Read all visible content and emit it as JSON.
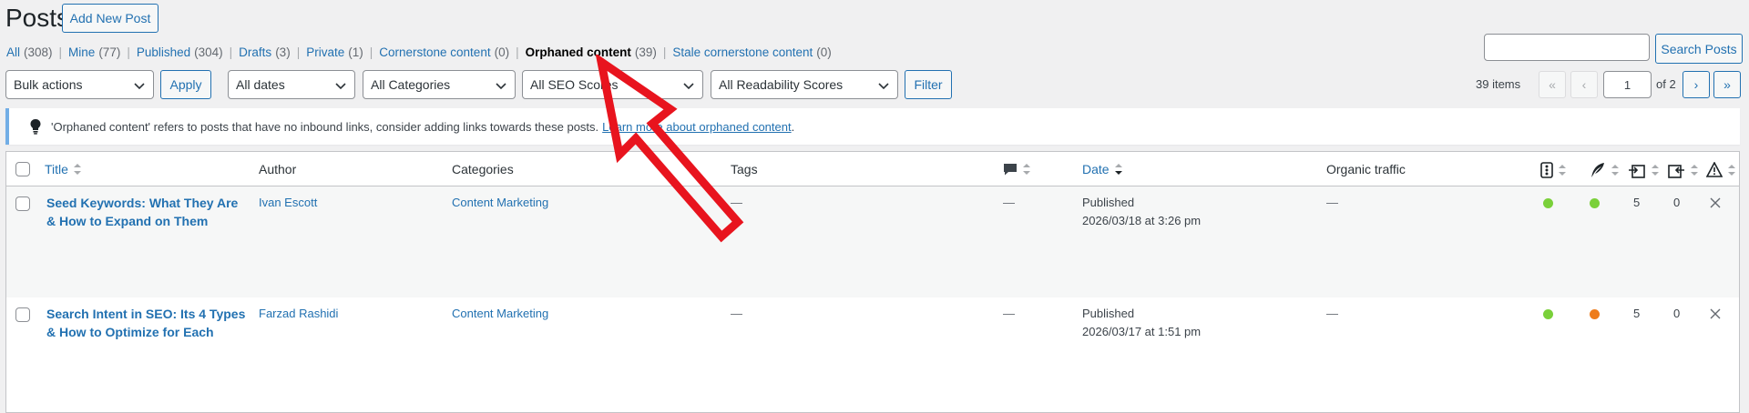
{
  "header": {
    "title": "Posts",
    "add_new": "Add New Post"
  },
  "views": [
    {
      "label": "All",
      "count": "(308)"
    },
    {
      "label": "Mine",
      "count": "(77)"
    },
    {
      "label": "Published",
      "count": "(304)"
    },
    {
      "label": "Drafts",
      "count": "(3)"
    },
    {
      "label": "Private",
      "count": "(1)"
    },
    {
      "label": "Cornerstone content",
      "count": "(0)"
    },
    {
      "label": "Orphaned content",
      "count": "(39)"
    },
    {
      "label": "Stale cornerstone content",
      "count": "(0)"
    }
  ],
  "search": {
    "value": "",
    "button": "Search Posts"
  },
  "filters": {
    "bulk": "Bulk actions",
    "apply": "Apply",
    "dates": "All dates",
    "categories": "All Categories",
    "seo": "All SEO Scores",
    "readability": "All Readability Scores",
    "filter": "Filter"
  },
  "pagination": {
    "items": "39 items",
    "first": "«",
    "prev": "‹",
    "page": "1",
    "of": "of 2",
    "next": "›",
    "last": "»"
  },
  "notice": {
    "text": "'Orphaned content' refers to posts that have no inbound links, consider adding links towards these posts.",
    "link": "Learn more about orphaned content",
    "period": "."
  },
  "columns": {
    "title": "Title",
    "author": "Author",
    "categories": "Categories",
    "tags": "Tags",
    "date": "Date",
    "organic": "Organic traffic"
  },
  "rows": [
    {
      "title_1": "Seed Keywords: What They Are",
      "title_2": "& How to Expand on Them",
      "author": "Ivan Escott",
      "category": "Content Marketing",
      "tags": "—",
      "comments": "—",
      "status": "Published",
      "date": "2026/03/18 at 3:26 pm",
      "organic": "—",
      "seo_color": "#7ad03a",
      "read_color": "#7ad03a",
      "links_out": "5",
      "links_in": "0"
    },
    {
      "title_1": "Search Intent in SEO: Its 4 Types",
      "title_2": "& How to Optimize for Each",
      "author": "Farzad Rashidi",
      "category": "Content Marketing",
      "tags": "—",
      "comments": "—",
      "status": "Published",
      "date": "2026/03/17 at 1:51 pm",
      "organic": "—",
      "seo_color": "#7ad03a",
      "read_color": "#ee7c1b",
      "links_out": "5",
      "links_in": "0"
    }
  ],
  "colors": {
    "accent": "#2271b1",
    "arrow": "#e8141e"
  }
}
